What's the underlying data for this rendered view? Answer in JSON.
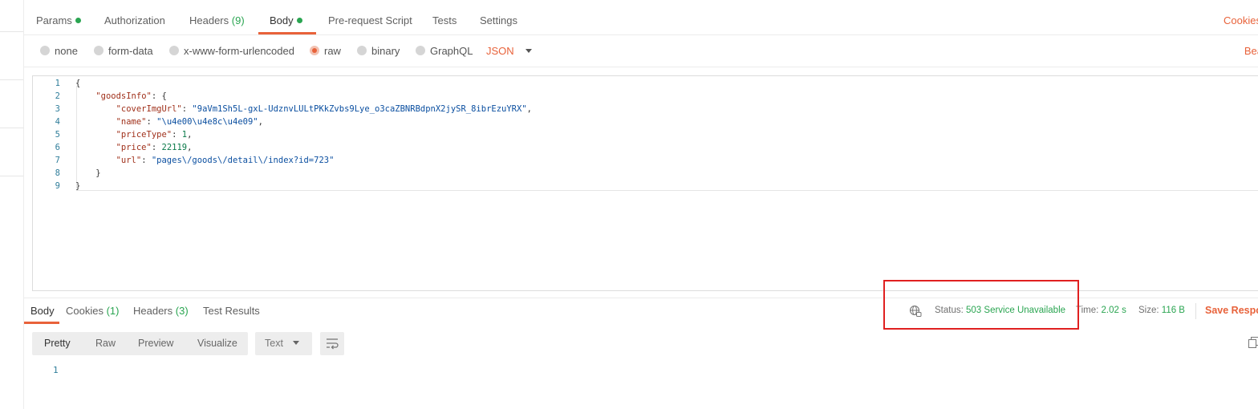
{
  "request_tabs": [
    {
      "label": "Params",
      "count": "",
      "dot": true
    },
    {
      "label": "Authorization",
      "count": "",
      "dot": false
    },
    {
      "label": "Headers",
      "count": "(9)",
      "dot": false
    },
    {
      "label": "Body",
      "count": "",
      "dot": true
    },
    {
      "label": "Pre-request Script",
      "count": "",
      "dot": false
    },
    {
      "label": "Tests",
      "count": "",
      "dot": false
    },
    {
      "label": "Settings",
      "count": "",
      "dot": false
    }
  ],
  "active_request_tab": "Body",
  "cookies_link": "Cookies",
  "body_types": [
    "none",
    "form-data",
    "x-www-form-urlencoded",
    "raw",
    "binary",
    "GraphQL"
  ],
  "selected_body_type": "raw",
  "format_select": "JSON",
  "beautify_link": "Bea",
  "editor_lines": [
    {
      "n": "1",
      "parts": [
        {
          "t": "p",
          "v": "{"
        }
      ]
    },
    {
      "n": "2",
      "parts": [
        {
          "t": "p",
          "v": "    "
        },
        {
          "t": "k",
          "v": "\"goodsInfo\""
        },
        {
          "t": "p",
          "v": ": {"
        }
      ]
    },
    {
      "n": "3",
      "parts": [
        {
          "t": "p",
          "v": "        "
        },
        {
          "t": "k",
          "v": "\"coverImgUrl\""
        },
        {
          "t": "p",
          "v": ": "
        },
        {
          "t": "s",
          "v": "\"9aVm1Sh5L-gxL-UdznvLULtPKkZvbs9Lye_o3caZBNRBdpnX2jySR_8ibrEzuYRX\""
        },
        {
          "t": "p",
          "v": ","
        }
      ]
    },
    {
      "n": "4",
      "parts": [
        {
          "t": "p",
          "v": "        "
        },
        {
          "t": "k",
          "v": "\"name\""
        },
        {
          "t": "p",
          "v": ": "
        },
        {
          "t": "s",
          "v": "\"\\u4e00\\u4e8c\\u4e09\""
        },
        {
          "t": "p",
          "v": ","
        }
      ]
    },
    {
      "n": "5",
      "parts": [
        {
          "t": "p",
          "v": "        "
        },
        {
          "t": "k",
          "v": "\"priceType\""
        },
        {
          "t": "p",
          "v": ": "
        },
        {
          "t": "n",
          "v": "1"
        },
        {
          "t": "p",
          "v": ","
        }
      ]
    },
    {
      "n": "6",
      "parts": [
        {
          "t": "p",
          "v": "        "
        },
        {
          "t": "k",
          "v": "\"price\""
        },
        {
          "t": "p",
          "v": ": "
        },
        {
          "t": "n",
          "v": "22119"
        },
        {
          "t": "p",
          "v": ","
        }
      ]
    },
    {
      "n": "7",
      "parts": [
        {
          "t": "p",
          "v": "        "
        },
        {
          "t": "k",
          "v": "\"url\""
        },
        {
          "t": "p",
          "v": ": "
        },
        {
          "t": "s",
          "v": "\"pages\\/goods\\/detail\\/index?id=723\""
        }
      ]
    },
    {
      "n": "8",
      "parts": [
        {
          "t": "p",
          "v": "    }"
        }
      ]
    },
    {
      "n": "9",
      "parts": [
        {
          "t": "p",
          "v": "}"
        }
      ]
    }
  ],
  "response_tabs": [
    {
      "label": "Body",
      "count": ""
    },
    {
      "label": "Cookies",
      "count": "(1)"
    },
    {
      "label": "Headers",
      "count": "(3)"
    },
    {
      "label": "Test Results",
      "count": ""
    }
  ],
  "status": {
    "status_label": "Status:",
    "status_value": "503 Service Unavailable",
    "time_label": "Time:",
    "time_value": "2.02 s",
    "size_label": "Size:",
    "size_value": "116 B"
  },
  "save_response": "Save Respo",
  "view_modes": [
    "Pretty",
    "Raw",
    "Preview",
    "Visualize"
  ],
  "active_view_mode": "Pretty",
  "text_select": "Text",
  "response_line_numbers": [
    "1"
  ],
  "colors": {
    "accent": "#e8623a",
    "success": "#2aa551",
    "highlight": "#e02020"
  },
  "icons": [
    "globe-icon",
    "wrap-lines-icon",
    "copy-icon",
    "chevron-down-icon"
  ]
}
